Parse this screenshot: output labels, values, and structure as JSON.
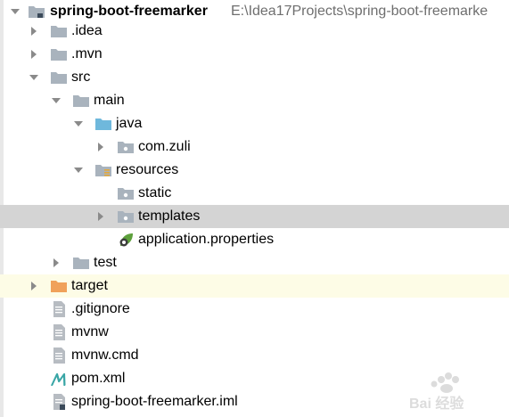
{
  "project": {
    "name": "spring-boot-freemarker",
    "path": "E:\\Idea17Projects\\spring-boot-freemarke"
  },
  "items": [
    {
      "label": ".idea"
    },
    {
      "label": ".mvn"
    },
    {
      "label": "src"
    },
    {
      "label": "main"
    },
    {
      "label": "java"
    },
    {
      "label": "com.zuli"
    },
    {
      "label": "resources"
    },
    {
      "label": "static"
    },
    {
      "label": "templates"
    },
    {
      "label": "application.properties"
    },
    {
      "label": "test"
    },
    {
      "label": "target"
    },
    {
      "label": ".gitignore"
    },
    {
      "label": "mvnw"
    },
    {
      "label": "mvnw.cmd"
    },
    {
      "label": "pom.xml"
    },
    {
      "label": "spring-boot-freemarker.iml"
    }
  ],
  "colors": {
    "selected_row": "#d4d4d4",
    "excluded_row": "#fdfce6",
    "folder_gray": "#a9b3bd",
    "folder_blue": "#6fb8dc",
    "folder_orange": "#f0a15a",
    "maven_teal": "#3aa6a6",
    "spring_green": "#5da03b"
  },
  "watermark": {
    "logo_text": "Bai 经验"
  }
}
